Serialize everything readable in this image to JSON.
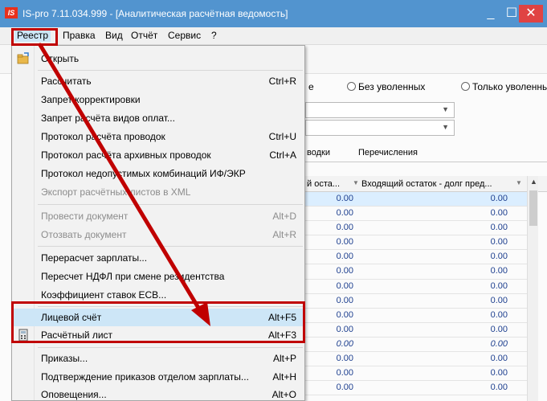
{
  "window": {
    "logo": "IS",
    "title": "IS-pro 7.11.034.999 - [Аналитическая расчётная ведомость]",
    "minimize": "_",
    "maximize": "☐",
    "close": "✕"
  },
  "menubar": {
    "items": [
      "Реестр",
      "Правка",
      "Вид",
      "Отчёт",
      "Сервис",
      "?"
    ],
    "active": "Реестр"
  },
  "background": {
    "radio_partial": "е",
    "radio_without_fired": "Без уволенных",
    "radio_only_fired": "Только уволенны",
    "tab_partial": "водки",
    "tab_transfers": "Перечисления",
    "col1_header": "й оста...",
    "col2_header": "Входящий остаток - долг пред...",
    "rows": [
      {
        "c1": "0.00",
        "c2": "0.00",
        "italic": false
      },
      {
        "c1": "0.00",
        "c2": "0.00",
        "italic": false
      },
      {
        "c1": "0.00",
        "c2": "0.00",
        "italic": false
      },
      {
        "c1": "0.00",
        "c2": "0.00",
        "italic": false
      },
      {
        "c1": "0.00",
        "c2": "0.00",
        "italic": false
      },
      {
        "c1": "0.00",
        "c2": "0.00",
        "italic": false
      },
      {
        "c1": "0.00",
        "c2": "0.00",
        "italic": false
      },
      {
        "c1": "0.00",
        "c2": "0.00",
        "italic": false
      },
      {
        "c1": "0.00",
        "c2": "0.00",
        "italic": false
      },
      {
        "c1": "0.00",
        "c2": "0.00",
        "italic": false
      },
      {
        "c1": "0.00",
        "c2": "0.00",
        "italic": true
      },
      {
        "c1": "0.00",
        "c2": "0.00",
        "italic": false
      },
      {
        "c1": "0.00",
        "c2": "0.00",
        "italic": false
      },
      {
        "c1": "0.00",
        "c2": "0.00",
        "italic": false
      }
    ]
  },
  "menu": {
    "open": "Открыть",
    "calculate": {
      "label": "Рассчитать",
      "shortcut": "Ctrl+R"
    },
    "forbid_edit": "Запрет корректировки",
    "forbid_calc": "Запрет расчёта видов оплат...",
    "protocol_postings": {
      "label": "Протокол расчёта проводок",
      "shortcut": "Ctrl+U"
    },
    "protocol_archive": {
      "label": "Протокол расчёта архивных проводок",
      "shortcut": "Ctrl+A"
    },
    "protocol_invalid": "Протокол недопустимых комбинаций ИФ/ЭКР",
    "export_xml": "Экспорт расчётных листов в XML",
    "post_document": {
      "label": "Провести документ",
      "shortcut": "Alt+D"
    },
    "recall_document": {
      "label": "Отозвать документ",
      "shortcut": "Alt+R"
    },
    "recalc_salary": "Перерасчет зарплаты...",
    "recalc_ndfl": "Пересчет НДФЛ при смене резидентства",
    "esv_rate": "Коэффициент ставок ЕСВ...",
    "personal_account": {
      "label": "Лицевой счёт",
      "shortcut": "Alt+F5"
    },
    "payslip": {
      "label": "Расчётный лист",
      "shortcut": "Alt+F3"
    },
    "orders": {
      "label": "Приказы...",
      "shortcut": "Alt+P"
    },
    "order_confirm": {
      "label": "Подтверждение приказов отделом зарплаты...",
      "shortcut": "Alt+H"
    },
    "notifications": {
      "label": "Оповещения...",
      "shortcut": "Alt+O"
    }
  },
  "colors": {
    "titlebar": "#5294cf",
    "highlight_box": "#c00000",
    "menu_hover": "#cde6f7",
    "value_text": "#1d3f8f"
  }
}
